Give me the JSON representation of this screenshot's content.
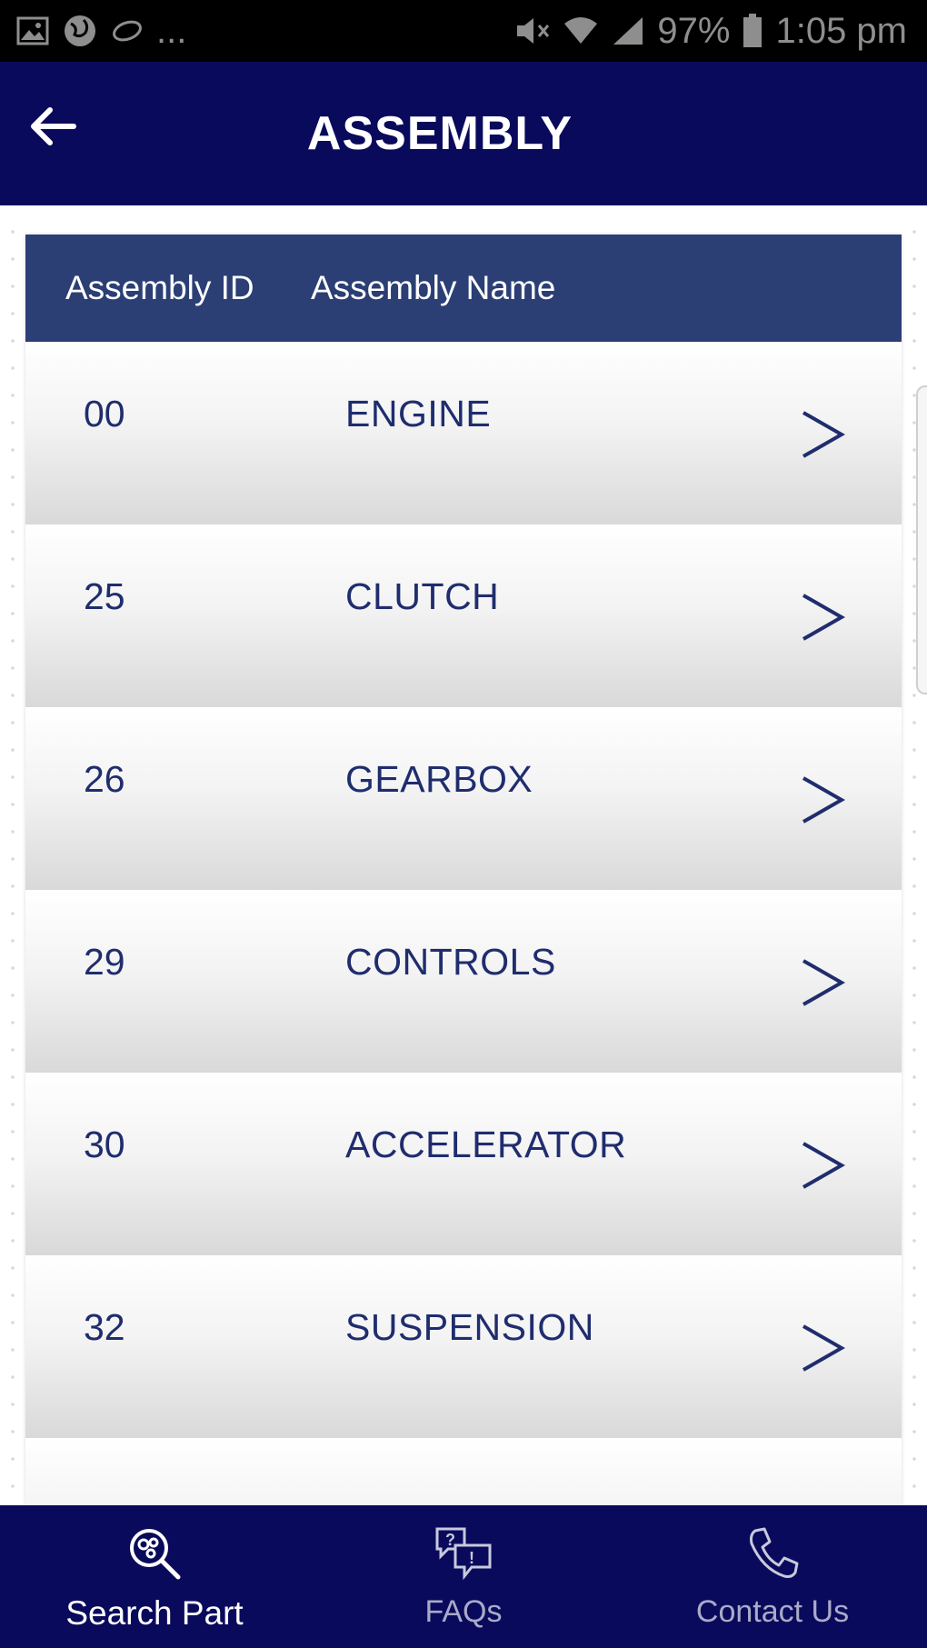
{
  "status_bar": {
    "battery_percent": "97%",
    "time": "1:05 pm",
    "overflow": "..."
  },
  "app_bar": {
    "title": "ASSEMBLY"
  },
  "table": {
    "headers": {
      "id": "Assembly ID",
      "name": "Assembly Name"
    },
    "rows": [
      {
        "id": "00",
        "name": "ENGINE"
      },
      {
        "id": "25",
        "name": "CLUTCH"
      },
      {
        "id": "26",
        "name": "GEARBOX"
      },
      {
        "id": "29",
        "name": "CONTROLS"
      },
      {
        "id": "30",
        "name": "ACCELERATOR"
      },
      {
        "id": "32",
        "name": "SUSPENSION"
      },
      {
        "id": "",
        "name": ""
      }
    ]
  },
  "bottom_nav": {
    "items": [
      {
        "label": "Search Part",
        "icon": "search-part-icon",
        "active": true
      },
      {
        "label": "FAQs",
        "icon": "faq-icon",
        "active": false
      },
      {
        "label": "Contact Us",
        "icon": "phone-icon",
        "active": false
      }
    ]
  },
  "colors": {
    "app_bar": "#0a0a5c",
    "table_header": "#2b3f75",
    "row_text": "#1f2d6e"
  }
}
